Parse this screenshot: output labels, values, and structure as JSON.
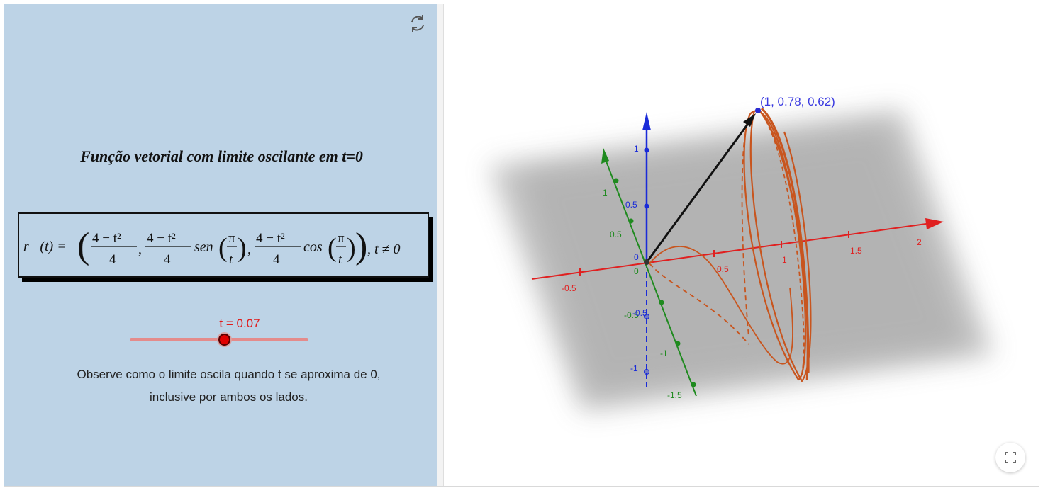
{
  "title": "Função vetorial com limite oscilante em t=0",
  "formula": {
    "lhs": "r⃗(t) =",
    "num": "4 − t²",
    "den": "4",
    "sen_word": "sen",
    "cos_word": "cos",
    "pi": "π",
    "t": "t",
    "tail": ", t ≠ 0"
  },
  "slider": {
    "label": "t = 0.07",
    "value": 0.07,
    "fraction": 0.53
  },
  "note": {
    "line1": "Observe como o limite oscila quando t se aproxima de 0,",
    "line2": "inclusive por ambos os lados."
  },
  "point_label": "(1, 0.78, 0.62)",
  "axes": {
    "x": [
      "-0.5",
      "0.5",
      "1",
      "1.5",
      "2"
    ],
    "y": [
      "1",
      "0.5",
      "-0.5",
      "-1",
      "-1.5"
    ],
    "z": [
      "1",
      "0.5",
      "-0.5",
      "-1"
    ],
    "origin": [
      "0",
      "0"
    ]
  },
  "icons": {
    "reset": "refresh-icon",
    "fullscreen": "fullscreen-icon"
  },
  "colors": {
    "x_axis": "#e02020",
    "y_axis": "#1f8a1f",
    "z_axis": "#1a2bd8",
    "curve": "#c8551e",
    "panel": "#bdd3e6",
    "slider": "#e00000"
  }
}
